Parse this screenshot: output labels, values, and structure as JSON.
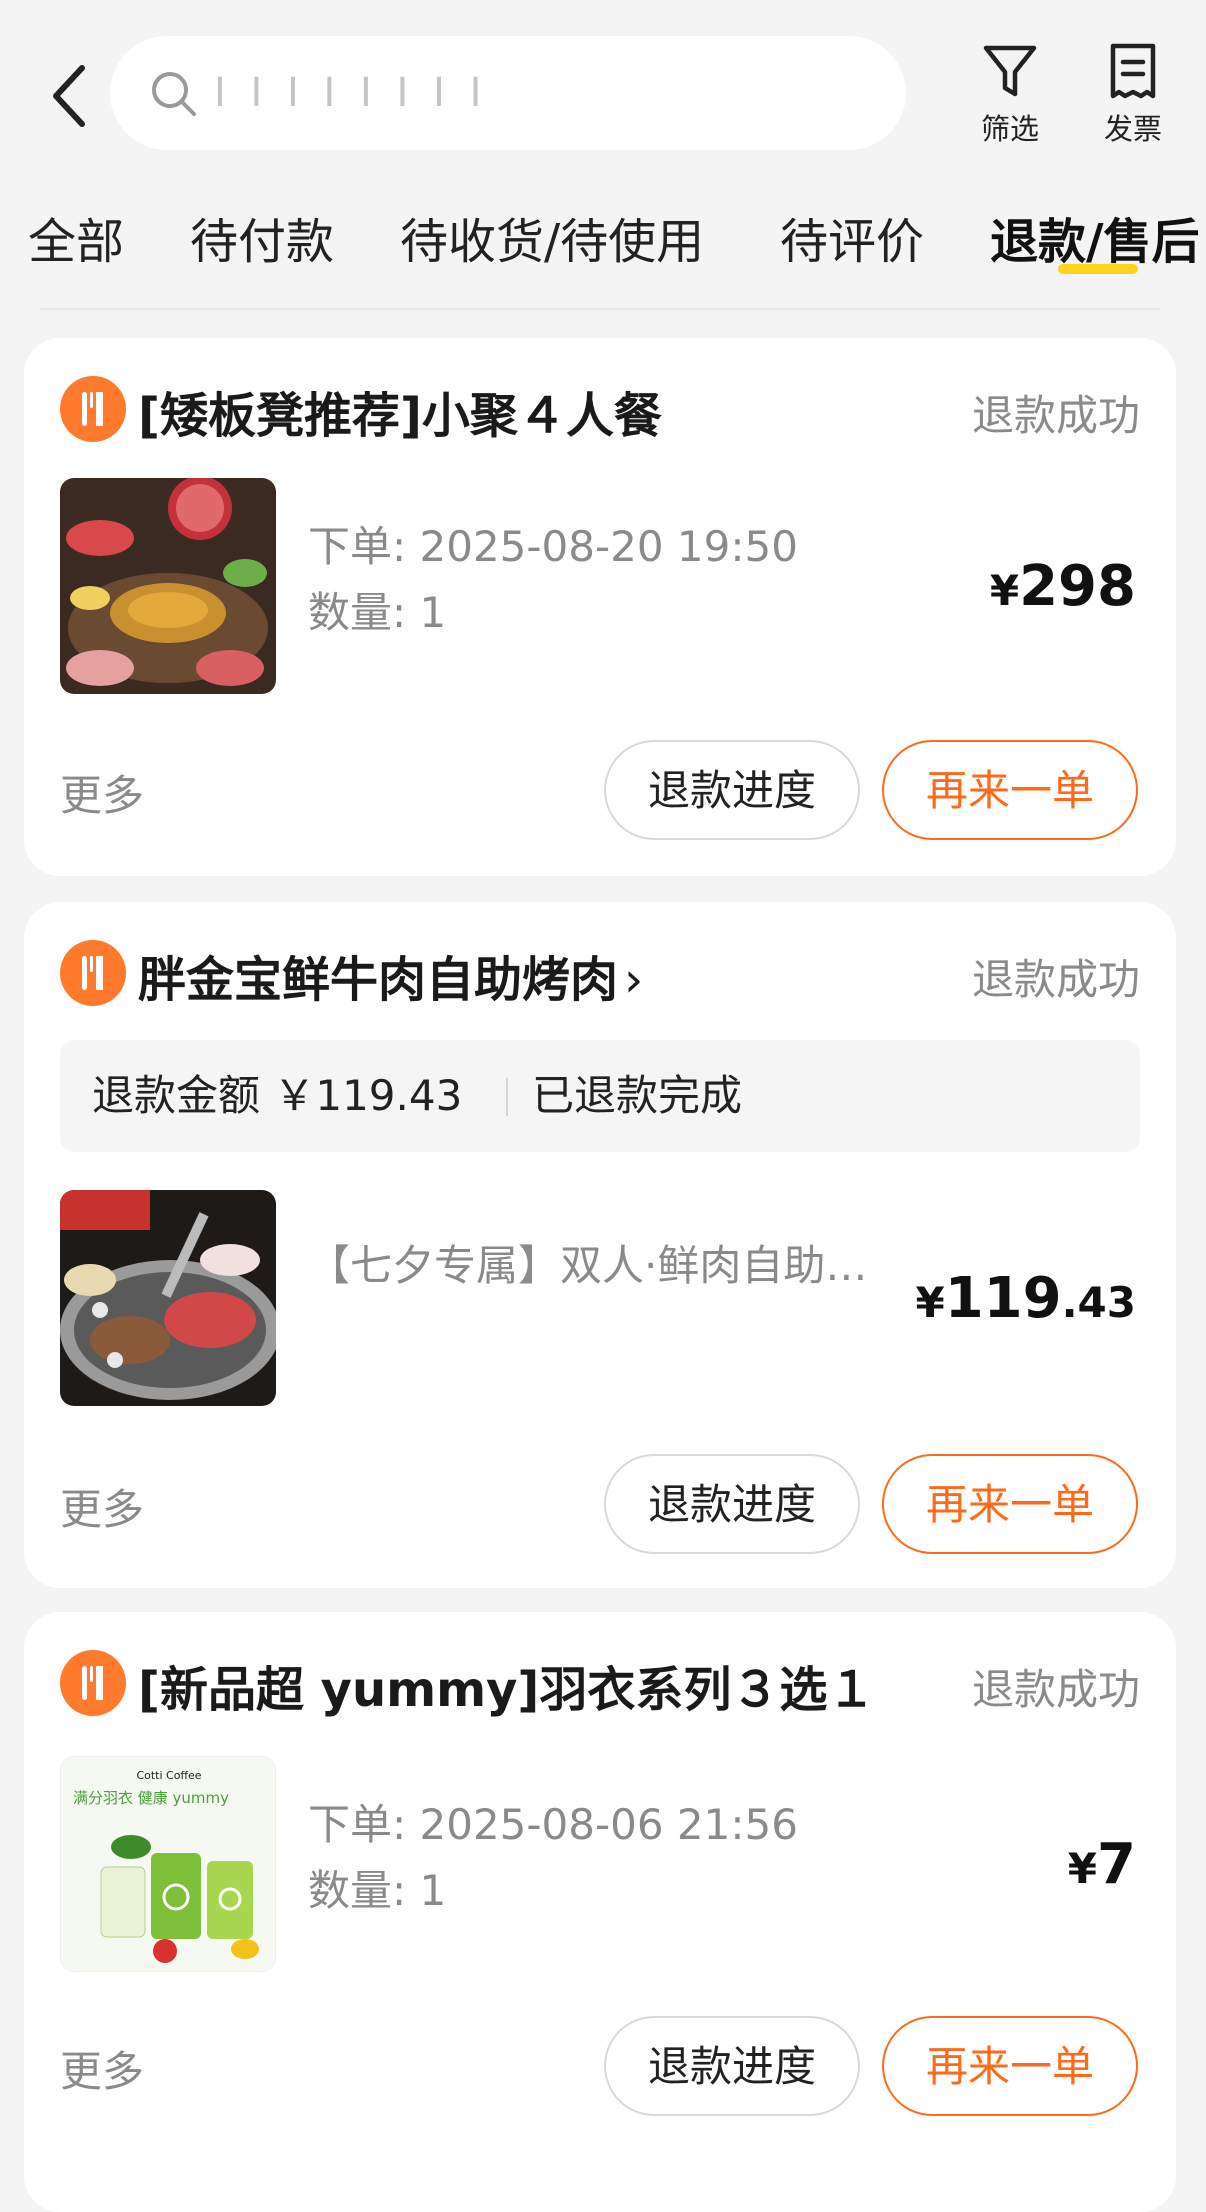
{
  "header": {
    "search_placeholder": "I I I I I  I I I",
    "filter_label": "筛选",
    "invoice_label": "发票"
  },
  "tabs": [
    {
      "label": "全部"
    },
    {
      "label": "待付款"
    },
    {
      "label": "待收货/待使用"
    },
    {
      "label": "待评价"
    },
    {
      "label": "退款/售后",
      "active": true
    }
  ],
  "colors": {
    "accent": "#ff6a1a",
    "tab_underline": "#ffd21e",
    "shop_icon": "#ff7a2c"
  },
  "orders": [
    {
      "shop_icon": "fork-knife-icon",
      "shop_name": "[矮板凳推荐]小聚４人餐",
      "status": "退款成功",
      "order_time": "下单: 2025-08-20 19:50",
      "quantity": "数量: 1",
      "price_currency": "¥",
      "price_int": "298",
      "price_dec": "",
      "more": "更多",
      "btn_progress": "退款进度",
      "btn_reorder": "再来一单"
    },
    {
      "shop_icon": "fork-knife-icon",
      "shop_name": "胖金宝鲜牛肉自助烤肉",
      "shop_chevron": "›",
      "status": "退款成功",
      "refund_amount": "退款金额 ￥119.43",
      "refund_state": "已退款完成",
      "item_title": "【七夕专属】双人·鲜肉自助…",
      "price_currency": "¥",
      "price_int": "119",
      "price_dec": ".43",
      "more": "更多",
      "btn_progress": "退款进度",
      "btn_reorder": "再来一单"
    },
    {
      "shop_icon": "fork-knife-icon",
      "shop_name": "[新品超 yummy]羽衣系列３选１",
      "status": "退款成功",
      "order_time": "下单: 2025-08-06 21:56",
      "quantity": "数量: 1",
      "price_currency": "¥",
      "price_int": "7",
      "price_dec": "",
      "more": "更多",
      "btn_progress": "退款进度",
      "btn_reorder": "再来一单",
      "thumb_brand": "Cotti Coffee",
      "thumb_slogan": "满分羽衣 健康 yummy"
    }
  ]
}
